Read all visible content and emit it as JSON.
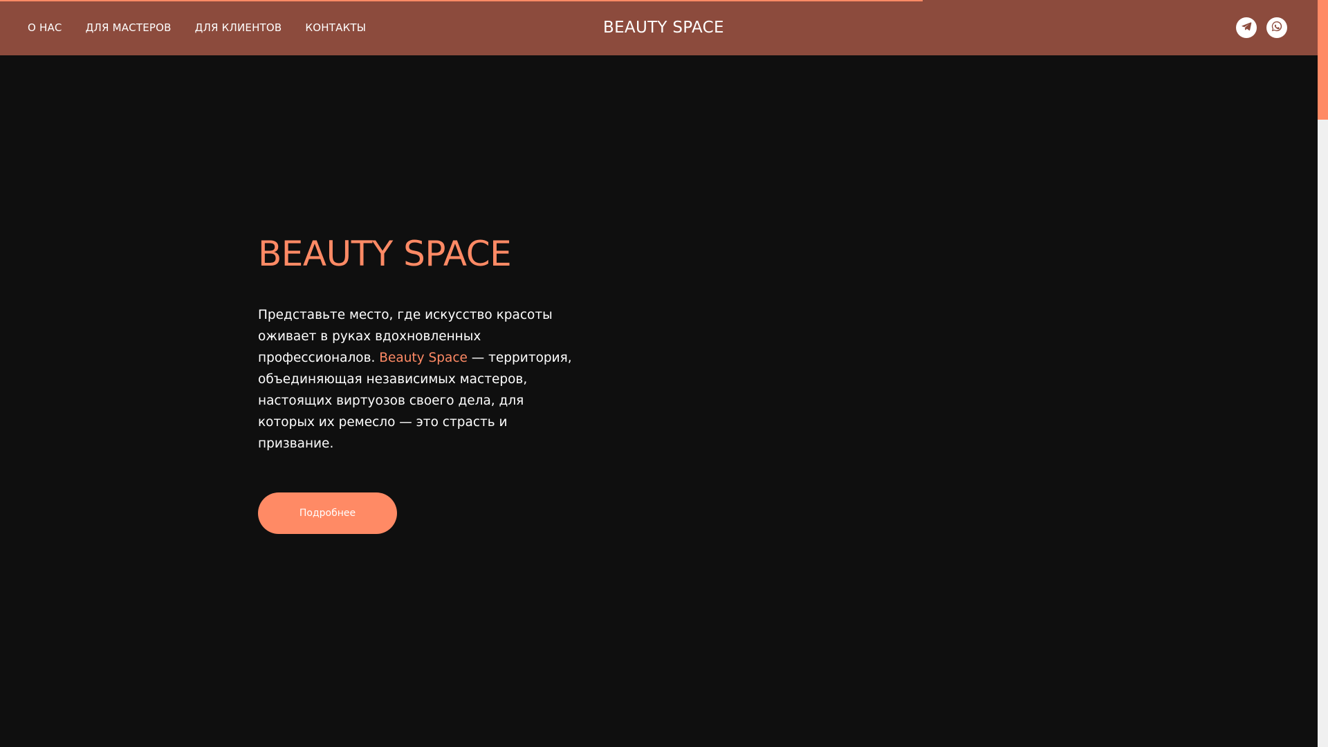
{
  "header": {
    "nav": [
      {
        "label": "О НАС"
      },
      {
        "label": "ДЛЯ МАСТЕРОВ"
      },
      {
        "label": "ДЛЯ КЛИЕНТОВ"
      },
      {
        "label": "КОНТАКТЫ"
      }
    ],
    "logo": "BEAUTY SPACE",
    "socials": [
      {
        "icon": "telegram-icon"
      },
      {
        "icon": "whatsapp-icon"
      }
    ],
    "scroll_progress": 0.7
  },
  "hero": {
    "title": "BEAUTY SPACE",
    "text_part1": "Представьте место, где искусство красоты оживает в руках вдохновленных профессионалов. ",
    "brand": "Beauty Space",
    "text_part2": " — территория, объединяющая независимых мастеров, настоящих виртуозов своего дела, для которых их ремесло — это страсть и призвание.",
    "button_label": "Подробнее"
  },
  "colors": {
    "accent": "#ff8a65",
    "header_bg": "#8c4b3d",
    "page_bg": "#0f0f0f"
  }
}
